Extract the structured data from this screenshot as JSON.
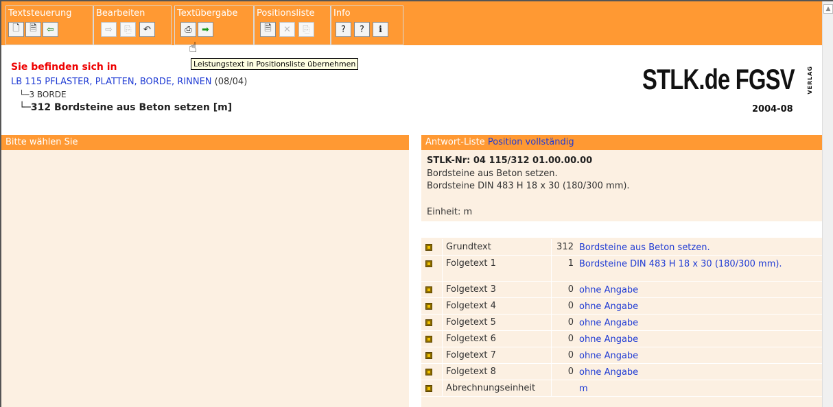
{
  "toolbar": {
    "groups": [
      {
        "title": "Textsteuerung"
      },
      {
        "title": "Bearbeiten"
      },
      {
        "title": "Textübergabe"
      },
      {
        "title": "Positionsliste"
      },
      {
        "title": "Info"
      }
    ],
    "tooltip": "Leistungstext in Positionsliste übernehmen"
  },
  "location": {
    "title": "Sie befinden sich in",
    "lb": "LB 115 PFLASTER, PLATTEN, BORDE, RINNEN",
    "lb_date": "(08/04)",
    "level3": "3 BORDE",
    "level312": "312 Bordsteine aus Beton setzen [m]"
  },
  "logo": {
    "text": "STLK.de FGSV",
    "verlag": "VERLAG",
    "date": "2004-08"
  },
  "left": {
    "header": "Bitte wählen Sie"
  },
  "right": {
    "header": "Antwort-Liste",
    "header_link": "Position vollständig",
    "stlk_nr": "STLK-Nr: 04 115/312 01.00.00.00",
    "desc1": "Bordsteine aus Beton setzen.",
    "desc2": "Bordsteine DIN 483 H 18 x 30 (180/300 mm).",
    "einheit": "Einheit: m",
    "rows": [
      {
        "name": "Grundtext",
        "num": "312",
        "value": "Bordsteine aus Beton setzen."
      },
      {
        "name": "Folgetext 1",
        "num": "1",
        "value": "Bordsteine DIN 483 H 18 x 30 (180/300 mm)."
      },
      {
        "name": "Folgetext 3",
        "num": "0",
        "value": "ohne Angabe"
      },
      {
        "name": "Folgetext 4",
        "num": "0",
        "value": "ohne Angabe"
      },
      {
        "name": "Folgetext 5",
        "num": "0",
        "value": "ohne Angabe"
      },
      {
        "name": "Folgetext 6",
        "num": "0",
        "value": "ohne Angabe"
      },
      {
        "name": "Folgetext 7",
        "num": "0",
        "value": "ohne Angabe"
      },
      {
        "name": "Folgetext 8",
        "num": "0",
        "value": "ohne Angabe"
      },
      {
        "name": "Abrechnungseinheit",
        "num": "",
        "value": "m"
      }
    ]
  },
  "colors": {
    "accent": "#ff9933",
    "panel": "#fcf0e2",
    "link": "#1f3bd4",
    "alert": "#ee0000"
  }
}
